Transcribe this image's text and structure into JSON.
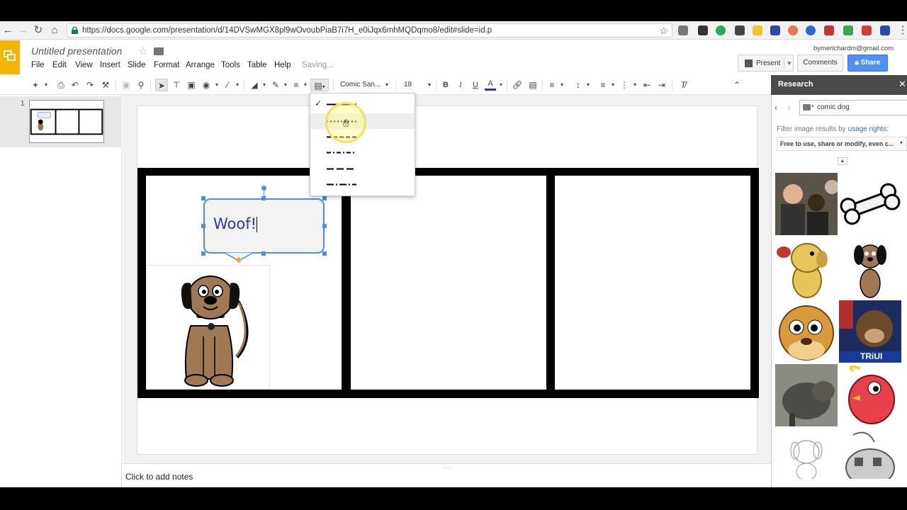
{
  "browser": {
    "url": "https://docs.google.com/presentation/d/14DVSwMGX8pl9wOvoubPiaB7i7H_e0iJqx6mhMQDqmo8/edit#slide=id.p"
  },
  "header": {
    "doc_title": "Untitled presentation",
    "status": "Saving...",
    "account_email": "bymerichardm@gmail.com",
    "present_label": "Present",
    "comments_label": "Comments",
    "share_label": "Share"
  },
  "menu": [
    "File",
    "Edit",
    "View",
    "Insert",
    "Slide",
    "Format",
    "Arrange",
    "Tools",
    "Table",
    "Help"
  ],
  "toolbar": {
    "font_name": "Comic San...",
    "font_size": "18"
  },
  "dash_dropdown": {
    "options": [
      "solid",
      "dotted",
      "dashed",
      "dash-dot",
      "long-dash",
      "long-dash-dot"
    ],
    "selected": "solid",
    "hovered": "dotted"
  },
  "filmstrip": {
    "slide_number": "1"
  },
  "slide": {
    "bubble_text": "Woof!"
  },
  "notes": {
    "placeholder": "Click to add notes"
  },
  "research": {
    "title": "Research",
    "query": "comic dog",
    "filter_prefix": "Filter image results by ",
    "filter_link": "usage rights",
    "filter_suffix": ":",
    "filter_value": "Free to use, share or modify, even c...",
    "results_overlay_text": "TRiUI"
  },
  "colors": {
    "docs_yellow": "#f4b400",
    "share_blue": "#4d90fe",
    "selection_blue": "#4a8df0",
    "bubble_text": "#2438b0"
  }
}
